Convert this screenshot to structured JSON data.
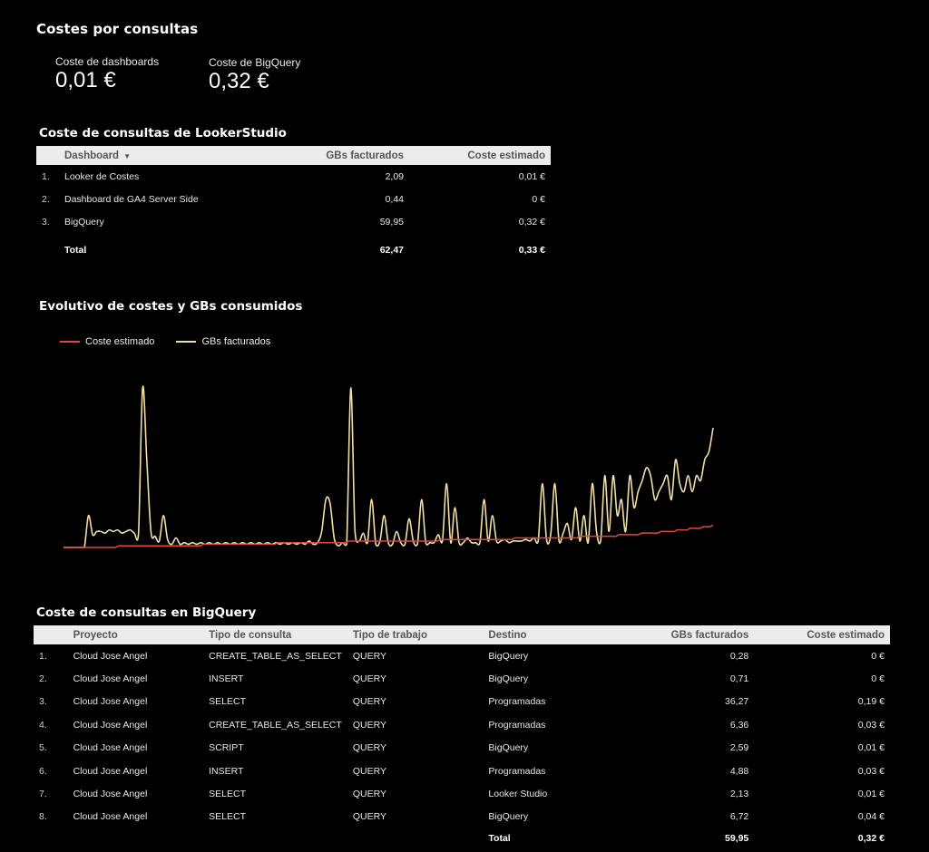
{
  "title": "Costes por consultas",
  "kpis": {
    "dashboards": {
      "label": "Coste de dashboards",
      "value": "0,01 €"
    },
    "bigquery": {
      "label": "Coste de BigQuery",
      "value": "0,32 €"
    }
  },
  "looker_table": {
    "title": "Coste de consultas de LookerStudio",
    "headers": {
      "dashboard": "Dashboard",
      "gbs": "GBs facturados",
      "cost": "Coste estimado"
    },
    "sort_icon": "sort-desc-icon",
    "rows": [
      {
        "idx": "1.",
        "dashboard": "Looker de Costes",
        "gbs": "2,09",
        "cost": "0,01 €"
      },
      {
        "idx": "2.",
        "dashboard": "Dashboard de GA4 Server Side",
        "gbs": "0,44",
        "cost": "0 €"
      },
      {
        "idx": "3.",
        "dashboard": "BigQuery",
        "gbs": "59,95",
        "cost": "0,32 €"
      }
    ],
    "total": {
      "label": "Total",
      "gbs": "62,47",
      "cost": "0,33 €"
    }
  },
  "chart_section": {
    "title": "Evolutivo de costes y GBs consumidos"
  },
  "chart_data": {
    "type": "line",
    "title": "Evolutivo de costes y GBs consumidos",
    "legend_position": "top-left",
    "grid": false,
    "series": [
      {
        "name": "Coste estimado",
        "color": "#e2473f",
        "values": [
          0,
          0,
          0,
          0,
          0,
          0,
          0,
          0,
          0,
          0,
          0,
          0,
          0,
          0,
          0,
          0,
          0,
          1,
          1,
          1,
          1,
          1,
          1,
          1,
          1,
          1,
          1,
          1,
          1,
          1,
          1,
          1,
          1,
          1,
          1,
          1,
          1,
          1,
          1,
          1,
          1,
          1,
          1,
          2,
          2,
          2,
          2,
          2,
          2,
          2,
          2,
          2,
          2,
          2,
          2,
          2,
          2,
          2,
          2,
          2,
          2,
          2,
          2,
          2,
          2,
          2,
          3,
          3,
          3,
          3,
          3,
          3,
          3,
          3,
          3,
          3,
          3,
          3,
          3,
          3,
          3,
          3,
          3,
          3,
          3,
          3,
          3,
          3,
          4,
          4,
          4,
          4,
          4,
          4,
          4,
          4,
          4,
          4,
          4,
          4,
          4,
          4,
          4,
          4,
          4,
          4,
          4,
          4,
          4,
          4,
          4,
          4,
          4,
          4,
          4,
          4,
          5,
          5,
          5,
          5,
          5,
          5,
          5,
          5,
          5,
          5,
          5,
          5,
          5,
          5,
          5,
          5,
          5,
          5,
          5,
          5,
          5,
          5,
          5,
          6,
          6,
          6,
          6,
          6,
          6,
          6,
          6,
          6,
          6,
          6,
          6,
          6,
          6,
          6,
          6,
          6,
          6,
          6,
          6,
          7,
          7,
          7,
          7,
          7,
          7,
          7,
          7,
          7,
          7,
          7,
          7,
          8,
          8,
          8,
          8,
          8,
          8,
          8,
          9,
          9,
          9,
          9,
          9,
          9,
          10,
          10,
          10,
          10,
          10,
          11,
          11,
          11,
          11,
          12,
          12,
          12,
          12,
          13,
          13,
          13,
          14
        ]
      },
      {
        "name": "GBs facturados",
        "color": "#f2dfa4",
        "values": [
          0,
          0,
          0,
          0,
          0,
          0,
          20,
          8,
          10,
          10,
          9,
          11,
          10,
          11,
          9,
          10,
          11,
          9,
          8,
          100,
          55,
          10,
          7,
          4,
          20,
          5,
          2,
          6,
          2,
          3,
          2,
          3,
          2,
          3,
          2,
          3,
          2,
          3,
          2,
          3,
          2,
          3,
          2,
          3,
          2,
          3,
          2,
          3,
          2,
          3,
          2,
          3,
          2,
          3,
          2,
          3,
          2,
          3,
          2,
          4,
          2,
          3,
          10,
          30,
          28,
          6,
          1,
          3,
          2,
          100,
          10,
          4,
          9,
          3,
          30,
          2,
          4,
          20,
          3,
          2,
          10,
          3,
          2,
          18,
          4,
          2,
          30,
          3,
          3,
          3,
          8,
          4,
          40,
          3,
          25,
          3,
          3,
          6,
          3,
          3,
          3,
          30,
          4,
          20,
          4,
          4,
          5,
          3,
          4,
          4,
          4,
          5,
          4,
          6,
          4,
          40,
          5,
          8,
          40,
          4,
          9,
          15,
          5,
          25,
          4,
          20,
          3,
          40,
          10,
          4,
          45,
          10,
          45,
          20,
          30,
          10,
          45,
          25,
          35,
          42,
          50,
          45,
          30,
          35,
          40,
          45,
          30,
          55,
          40,
          35,
          45,
          35,
          45,
          42,
          55,
          60,
          75
        ]
      }
    ]
  },
  "bq_table": {
    "title": "Coste de consultas en BigQuery",
    "headers": {
      "project": "Proyecto",
      "query_type": "Tipo de consulta",
      "job_type": "Tipo de trabajo",
      "destination": "Destino",
      "gbs": "GBs facturados",
      "cost": "Coste estimado"
    },
    "rows": [
      {
        "idx": "1.",
        "project": "Cloud Jose Angel",
        "query_type": "CREATE_TABLE_AS_SELECT",
        "job_type": "QUERY",
        "destination": "BigQuery",
        "gbs": "0,28",
        "cost": "0 €"
      },
      {
        "idx": "2.",
        "project": "Cloud Jose Angel",
        "query_type": "INSERT",
        "job_type": "QUERY",
        "destination": "BigQuery",
        "gbs": "0,71",
        "cost": "0 €"
      },
      {
        "idx": "3.",
        "project": "Cloud Jose Angel",
        "query_type": "SELECT",
        "job_type": "QUERY",
        "destination": "Programadas",
        "gbs": "36,27",
        "cost": "0,19 €"
      },
      {
        "idx": "4.",
        "project": "Cloud Jose Angel",
        "query_type": "CREATE_TABLE_AS_SELECT",
        "job_type": "QUERY",
        "destination": "Programadas",
        "gbs": "6,36",
        "cost": "0,03 €"
      },
      {
        "idx": "5.",
        "project": "Cloud Jose Angel",
        "query_type": "SCRIPT",
        "job_type": "QUERY",
        "destination": "BigQuery",
        "gbs": "2,59",
        "cost": "0,01 €"
      },
      {
        "idx": "6.",
        "project": "Cloud Jose Angel",
        "query_type": "INSERT",
        "job_type": "QUERY",
        "destination": "Programadas",
        "gbs": "4,88",
        "cost": "0,03 €"
      },
      {
        "idx": "7.",
        "project": "Cloud Jose Angel",
        "query_type": "SELECT",
        "job_type": "QUERY",
        "destination": "Looker Studio",
        "gbs": "2,13",
        "cost": "0,01 €"
      },
      {
        "idx": "8.",
        "project": "Cloud Jose Angel",
        "query_type": "SELECT",
        "job_type": "QUERY",
        "destination": "BigQuery",
        "gbs": "6,72",
        "cost": "0,04 €"
      }
    ],
    "total": {
      "label": "Total",
      "gbs": "59,95",
      "cost": "0,32 €"
    }
  }
}
